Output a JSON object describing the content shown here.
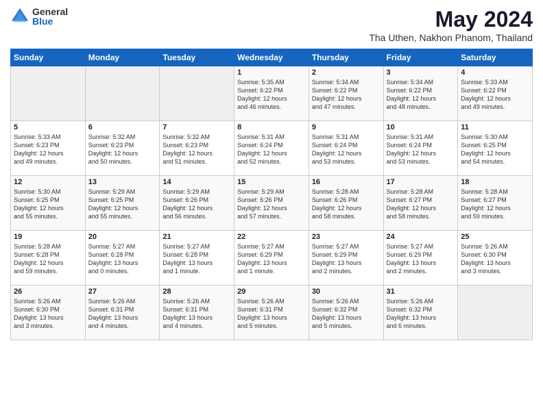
{
  "logo": {
    "general": "General",
    "blue": "Blue"
  },
  "title": {
    "month_year": "May 2024",
    "location": "Tha Uthen, Nakhon Phanom, Thailand"
  },
  "days_of_week": [
    "Sunday",
    "Monday",
    "Tuesday",
    "Wednesday",
    "Thursday",
    "Friday",
    "Saturday"
  ],
  "weeks": [
    [
      {
        "day": "",
        "info": ""
      },
      {
        "day": "",
        "info": ""
      },
      {
        "day": "",
        "info": ""
      },
      {
        "day": "1",
        "info": "Sunrise: 5:35 AM\nSunset: 6:22 PM\nDaylight: 12 hours\nand 46 minutes."
      },
      {
        "day": "2",
        "info": "Sunrise: 5:34 AM\nSunset: 6:22 PM\nDaylight: 12 hours\nand 47 minutes."
      },
      {
        "day": "3",
        "info": "Sunrise: 5:34 AM\nSunset: 6:22 PM\nDaylight: 12 hours\nand 48 minutes."
      },
      {
        "day": "4",
        "info": "Sunrise: 5:33 AM\nSunset: 6:22 PM\nDaylight: 12 hours\nand 49 minutes."
      }
    ],
    [
      {
        "day": "5",
        "info": "Sunrise: 5:33 AM\nSunset: 6:23 PM\nDaylight: 12 hours\nand 49 minutes."
      },
      {
        "day": "6",
        "info": "Sunrise: 5:32 AM\nSunset: 6:23 PM\nDaylight: 12 hours\nand 50 minutes."
      },
      {
        "day": "7",
        "info": "Sunrise: 5:32 AM\nSunset: 6:23 PM\nDaylight: 12 hours\nand 51 minutes."
      },
      {
        "day": "8",
        "info": "Sunrise: 5:31 AM\nSunset: 6:24 PM\nDaylight: 12 hours\nand 52 minutes."
      },
      {
        "day": "9",
        "info": "Sunrise: 5:31 AM\nSunset: 6:24 PM\nDaylight: 12 hours\nand 53 minutes."
      },
      {
        "day": "10",
        "info": "Sunrise: 5:31 AM\nSunset: 6:24 PM\nDaylight: 12 hours\nand 53 minutes."
      },
      {
        "day": "11",
        "info": "Sunrise: 5:30 AM\nSunset: 6:25 PM\nDaylight: 12 hours\nand 54 minutes."
      }
    ],
    [
      {
        "day": "12",
        "info": "Sunrise: 5:30 AM\nSunset: 6:25 PM\nDaylight: 12 hours\nand 55 minutes."
      },
      {
        "day": "13",
        "info": "Sunrise: 5:29 AM\nSunset: 6:25 PM\nDaylight: 12 hours\nand 55 minutes."
      },
      {
        "day": "14",
        "info": "Sunrise: 5:29 AM\nSunset: 6:26 PM\nDaylight: 12 hours\nand 56 minutes."
      },
      {
        "day": "15",
        "info": "Sunrise: 5:29 AM\nSunset: 6:26 PM\nDaylight: 12 hours\nand 57 minutes."
      },
      {
        "day": "16",
        "info": "Sunrise: 5:28 AM\nSunset: 6:26 PM\nDaylight: 12 hours\nand 58 minutes."
      },
      {
        "day": "17",
        "info": "Sunrise: 5:28 AM\nSunset: 6:27 PM\nDaylight: 12 hours\nand 58 minutes."
      },
      {
        "day": "18",
        "info": "Sunrise: 5:28 AM\nSunset: 6:27 PM\nDaylight: 12 hours\nand 59 minutes."
      }
    ],
    [
      {
        "day": "19",
        "info": "Sunrise: 5:28 AM\nSunset: 6:28 PM\nDaylight: 12 hours\nand 59 minutes."
      },
      {
        "day": "20",
        "info": "Sunrise: 5:27 AM\nSunset: 6:28 PM\nDaylight: 13 hours\nand 0 minutes."
      },
      {
        "day": "21",
        "info": "Sunrise: 5:27 AM\nSunset: 6:28 PM\nDaylight: 13 hours\nand 1 minute."
      },
      {
        "day": "22",
        "info": "Sunrise: 5:27 AM\nSunset: 6:29 PM\nDaylight: 13 hours\nand 1 minute."
      },
      {
        "day": "23",
        "info": "Sunrise: 5:27 AM\nSunset: 6:29 PM\nDaylight: 13 hours\nand 2 minutes."
      },
      {
        "day": "24",
        "info": "Sunrise: 5:27 AM\nSunset: 6:29 PM\nDaylight: 13 hours\nand 2 minutes."
      },
      {
        "day": "25",
        "info": "Sunrise: 5:26 AM\nSunset: 6:30 PM\nDaylight: 13 hours\nand 3 minutes."
      }
    ],
    [
      {
        "day": "26",
        "info": "Sunrise: 5:26 AM\nSunset: 6:30 PM\nDaylight: 13 hours\nand 3 minutes."
      },
      {
        "day": "27",
        "info": "Sunrise: 5:26 AM\nSunset: 6:31 PM\nDaylight: 13 hours\nand 4 minutes."
      },
      {
        "day": "28",
        "info": "Sunrise: 5:26 AM\nSunset: 6:31 PM\nDaylight: 13 hours\nand 4 minutes."
      },
      {
        "day": "29",
        "info": "Sunrise: 5:26 AM\nSunset: 6:31 PM\nDaylight: 13 hours\nand 5 minutes."
      },
      {
        "day": "30",
        "info": "Sunrise: 5:26 AM\nSunset: 6:32 PM\nDaylight: 13 hours\nand 5 minutes."
      },
      {
        "day": "31",
        "info": "Sunrise: 5:26 AM\nSunset: 6:32 PM\nDaylight: 13 hours\nand 6 minutes."
      },
      {
        "day": "",
        "info": ""
      }
    ]
  ]
}
